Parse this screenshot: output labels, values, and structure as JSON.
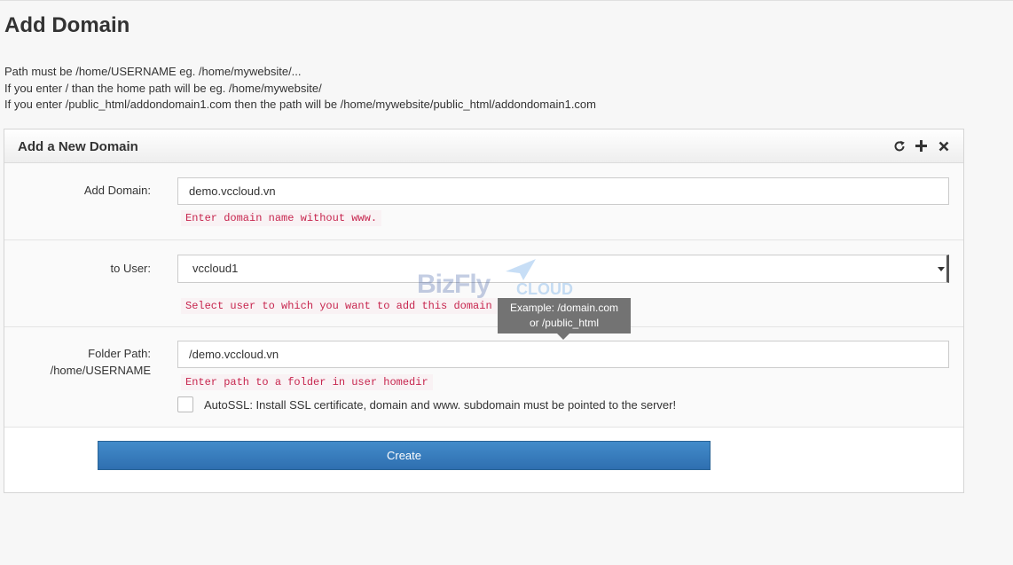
{
  "page": {
    "title": "Add Domain",
    "help_lines": [
      "Path must be /home/USERNAME eg. /home/mywebsite/...",
      "If you enter / than the home path will be eg. /home/mywebsite/",
      "If you enter /public_html/addondomain1.com then the path will be /home/mywebsite/public_html/addondomain1.com"
    ]
  },
  "widget": {
    "title": "Add a New Domain",
    "toolbar_icons": [
      "refresh-icon",
      "plus-icon",
      "close-icon"
    ]
  },
  "form": {
    "domain": {
      "label": "Add Domain:",
      "value": "demo.vccloud.vn",
      "hint": "Enter domain name without www."
    },
    "user": {
      "label": "to User:",
      "selected": "vccloud1",
      "hint": "Select user to which you want to add this domain"
    },
    "folder": {
      "label_line1": "Folder Path:",
      "label_line2": "/home/USERNAME",
      "value": "/demo.vccloud.vn",
      "hint": "Enter path to a folder in user homedir"
    },
    "autossl": {
      "label": "AutoSSL: Install SSL certificate, domain and www. subdomain must be pointed to the server!",
      "checked": false
    },
    "submit_label": "Create"
  },
  "tooltip": {
    "line1": "Example: /domain.com",
    "line2": "or /public_html"
  },
  "watermark": {
    "brand": "BizFly",
    "suffix": "CLOUD"
  },
  "colors": {
    "primary_button": "#428bca",
    "hint_text": "#c7254e",
    "hint_bg": "#f9f2f4",
    "tooltip_bg": "#737373"
  }
}
